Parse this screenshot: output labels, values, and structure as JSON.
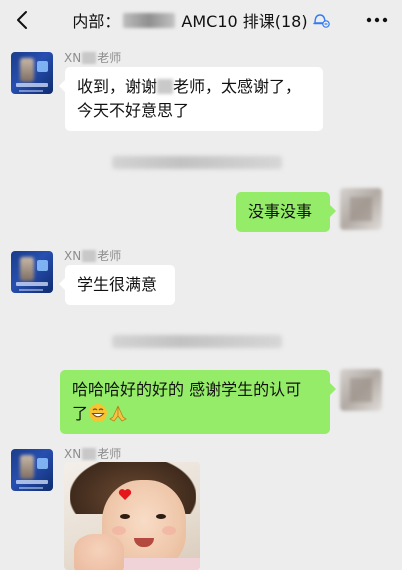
{
  "header": {
    "title_prefix": "内部：",
    "title_suffix": "AMC10 排课(18)",
    "back_icon": "chevron-left-icon",
    "mute_icon": "muted-bell-icon",
    "more_icon": "more-horizontal-icon"
  },
  "messages": [
    {
      "side": "in",
      "sender_prefix": "XN",
      "sender_suffix": "老师",
      "lines": [
        "收到，谢谢",
        "老师，太感谢了，",
        "今天不好意思了"
      ]
    },
    {
      "side": "out",
      "text": "没事没事"
    },
    {
      "side": "in",
      "sender_prefix": "XN",
      "sender_suffix": "老师",
      "text": "学生很满意"
    },
    {
      "side": "out",
      "line1": "哈哈哈好的好的 感谢学生的认可",
      "line2": "了",
      "emojis": [
        "grinning-face-emoji",
        "folded-hands-emoji"
      ]
    },
    {
      "side": "in",
      "sender_prefix": "XN",
      "sender_suffix": "老师",
      "type": "image",
      "image_desc": "photo of a smiling child holding a red heart"
    }
  ],
  "colors": {
    "background": "#ededed",
    "incoming_bubble": "#ffffff",
    "outgoing_bubble": "#95ec69",
    "sender_name": "#8d8d8d",
    "mute_icon": "#2f7bf5"
  }
}
